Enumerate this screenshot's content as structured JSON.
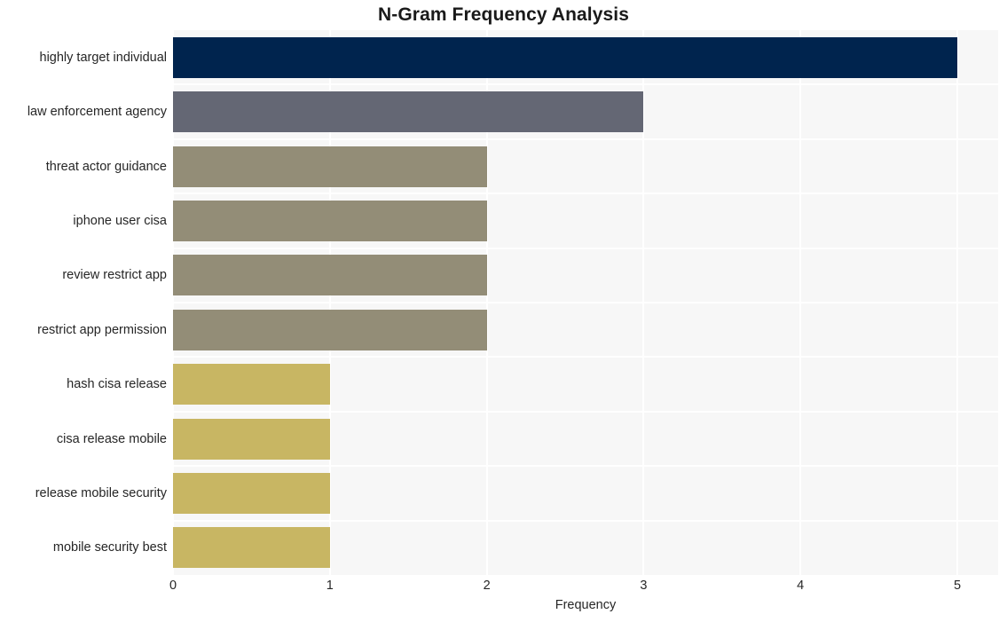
{
  "chart_data": {
    "type": "bar",
    "orientation": "horizontal",
    "title": "N-Gram Frequency Analysis",
    "xlabel": "Frequency",
    "ylabel": "",
    "xlim": [
      0,
      5.26
    ],
    "xticks": [
      0,
      1,
      2,
      3,
      4,
      5
    ],
    "xtick_labels": [
      "0",
      "1",
      "2",
      "3",
      "4",
      "5"
    ],
    "grid": true,
    "legend": null,
    "categories": [
      "highly target individual",
      "law enforcement agency",
      "threat actor guidance",
      "iphone user cisa",
      "review restrict app",
      "restrict app permission",
      "hash cisa release",
      "cisa release mobile",
      "release mobile security",
      "mobile security best"
    ],
    "values": [
      5,
      3,
      2,
      2,
      2,
      2,
      1,
      1,
      1,
      1
    ],
    "bar_colors": [
      "#00244e",
      "#646774",
      "#938d77",
      "#938d77",
      "#938d77",
      "#938d77",
      "#c8b663",
      "#c8b663",
      "#c8b663",
      "#c8b663"
    ],
    "plot_background": "#f7f7f7",
    "grid_color": "#ffffff",
    "figure_background": "#ffffff"
  }
}
